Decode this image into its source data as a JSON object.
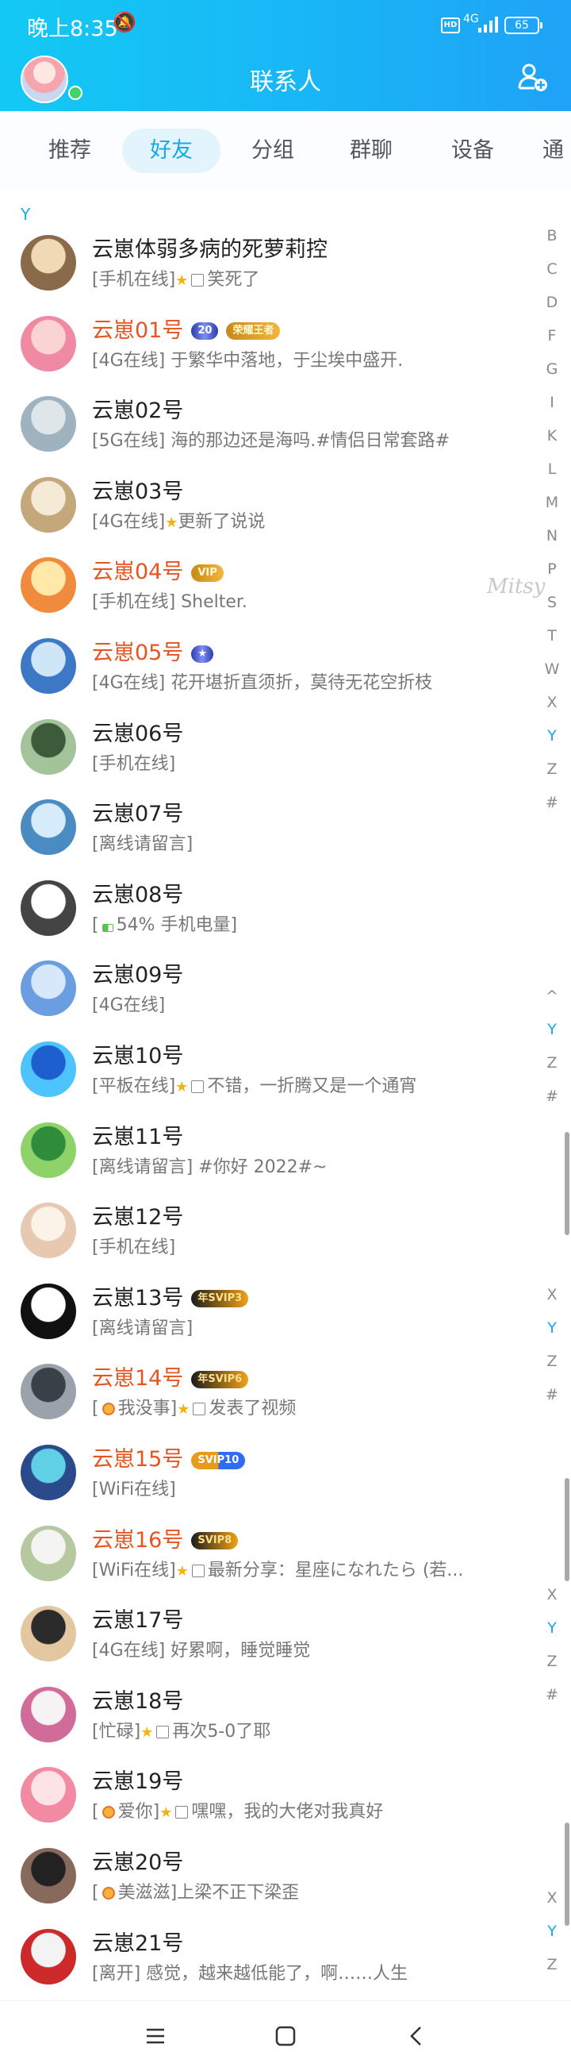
{
  "status_bar": {
    "time": "晚上8:35",
    "network": "4G",
    "hd": "HD",
    "battery": "65"
  },
  "header": {
    "title": "联系人"
  },
  "tabs": [
    "推荐",
    "好友",
    "分组",
    "群聊",
    "设备",
    "通"
  ],
  "active_tab": "好友",
  "section_letter": "Y",
  "contacts": [
    {
      "name": "云崽体弱多病的死萝莉控",
      "state": "[手机在线]",
      "note": "笑死了",
      "vip": false,
      "star": true,
      "img": true
    },
    {
      "name": "云崽01号",
      "state": "[4G在线]",
      "note": "于繁华中落地，于尘埃中盛开.",
      "vip": true,
      "badges": [
        "20",
        "荣耀王者"
      ]
    },
    {
      "name": "云崽02号",
      "state": "[5G在线]",
      "note": "海的那边还是海吗.#情侣日常套路#",
      "vip": false
    },
    {
      "name": "云崽03号",
      "state": "[4G在线]",
      "note": "更新了说说",
      "vip": false,
      "star": true
    },
    {
      "name": "云崽04号",
      "state": "[手机在线]",
      "note": "Shelter.",
      "vip": true,
      "badges": [
        "VIP"
      ]
    },
    {
      "name": "云崽05号",
      "state": "[4G在线]",
      "note": "花开堪折直须折，莫待无花空折枝",
      "vip": true,
      "badges": [
        "★"
      ]
    },
    {
      "name": "云崽06号",
      "state": "[手机在线]",
      "note": "",
      "vip": false
    },
    {
      "name": "云崽07号",
      "state": "[离线请留言]",
      "note": "",
      "vip": false
    },
    {
      "name": "云崽08号",
      "state": "[",
      "note": "54% 手机电量]",
      "vip": false,
      "battery": true
    },
    {
      "name": "云崽09号",
      "state": "[4G在线]",
      "note": "",
      "vip": false
    },
    {
      "name": "云崽10号",
      "state": "[平板在线]",
      "note": "不错，一折腾又是一个通宵",
      "vip": false,
      "star": true,
      "img": true
    },
    {
      "name": "云崽11号",
      "state": "[离线请留言]",
      "note": "#你好 2022#~",
      "vip": false
    },
    {
      "name": "云崽12号",
      "state": "[手机在线]",
      "note": "",
      "vip": false
    },
    {
      "name": "云崽13号",
      "state": "[离线请留言]",
      "note": "",
      "vip": false,
      "badges": [
        "年SVIP3"
      ]
    },
    {
      "name": "云崽14号",
      "state": "[",
      "note": "我没事]",
      "note2": "发表了视频",
      "vip": true,
      "badges": [
        "年SVIP6"
      ],
      "star": true,
      "img": true,
      "dot": true
    },
    {
      "name": "云崽15号",
      "state": "[WiFi在线]",
      "note": "",
      "vip": true,
      "badges": [
        "SVIP10"
      ]
    },
    {
      "name": "云崽16号",
      "state": "[WiFi在线]",
      "note": "最新分享：星座になれたら (若...",
      "vip": true,
      "badges": [
        "SVIP8"
      ],
      "star": true,
      "img": true
    },
    {
      "name": "云崽17号",
      "state": "[4G在线]",
      "note": "好累啊，睡觉睡觉",
      "vip": false
    },
    {
      "name": "云崽18号",
      "state": "[忙碌]",
      "note": "再次5-0了耶",
      "vip": false,
      "star": true,
      "img": true
    },
    {
      "name": "云崽19号",
      "state": "[",
      "note": "爱你]",
      "note2": "嘿嘿，我的大佬对我真好",
      "vip": false,
      "star": true,
      "img": true,
      "dot": true
    },
    {
      "name": "云崽20号",
      "state": "[",
      "note": "美滋滋]上梁不正下梁歪",
      "vip": false,
      "dot": true
    },
    {
      "name": "云崽21号",
      "state": "[离开]",
      "note": "感觉，越来越低能了，啊……人生",
      "vip": false
    }
  ],
  "index_bar": [
    "B",
    "C",
    "D",
    "F",
    "G",
    "I",
    "K",
    "L",
    "M",
    "N",
    "P",
    "S",
    "T",
    "W",
    "X",
    "Y",
    "Z",
    "#"
  ],
  "index_current": "Y",
  "watermark": "Mitsy",
  "colors": {
    "accent": "#19a8ea",
    "vip_name": "#e7541e",
    "header_start": "#13c9f4",
    "header_end": "#1fa2f7"
  }
}
